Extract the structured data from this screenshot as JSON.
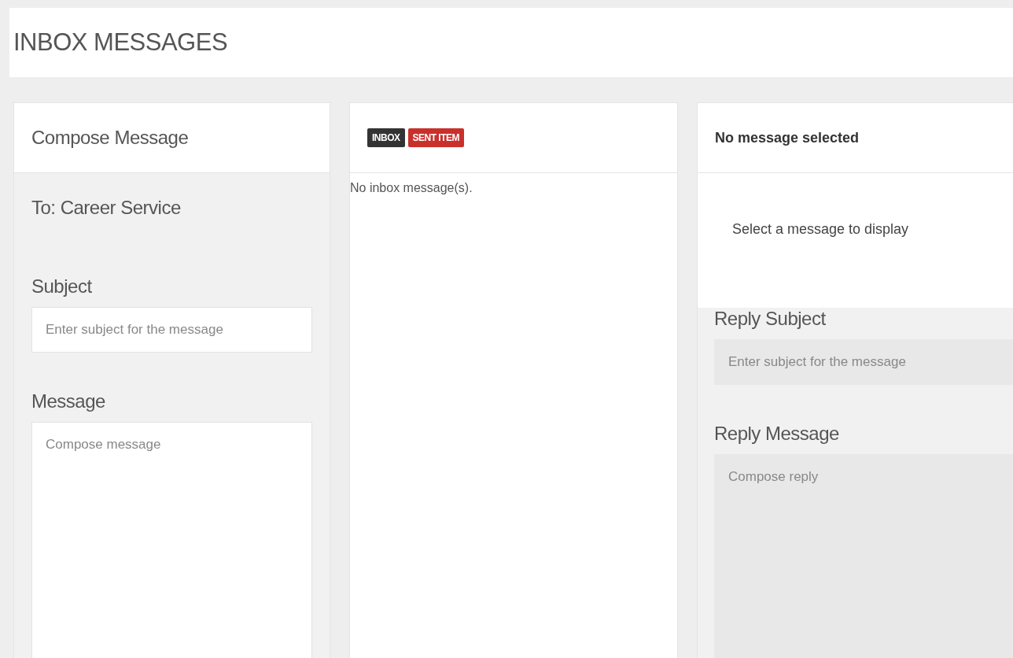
{
  "page_title": "INBOX MESSAGES",
  "compose": {
    "title": "Compose Message",
    "to": "To: Career Service",
    "subject_label": "Subject",
    "subject_field": {
      "placeholder": "Enter subject for the message",
      "disabled": false
    },
    "message_label": "Message",
    "message_field": {
      "placeholder": "Compose message",
      "disabled": false
    }
  },
  "list": {
    "tabs": [
      {
        "label": "INBOX",
        "color": "#333333"
      },
      {
        "label": "SENT ITEM",
        "color": "#c9302c"
      }
    ],
    "empty_text": "No inbox message(s)."
  },
  "reader": {
    "title": "No message selected",
    "body": "Select a message to display",
    "subject_label": "Reply Subject",
    "subject_field": {
      "placeholder": "Enter subject for the message",
      "disabled": true
    },
    "message_label": "Reply Message",
    "message_field": {
      "placeholder": "Compose reply",
      "disabled": true
    }
  }
}
